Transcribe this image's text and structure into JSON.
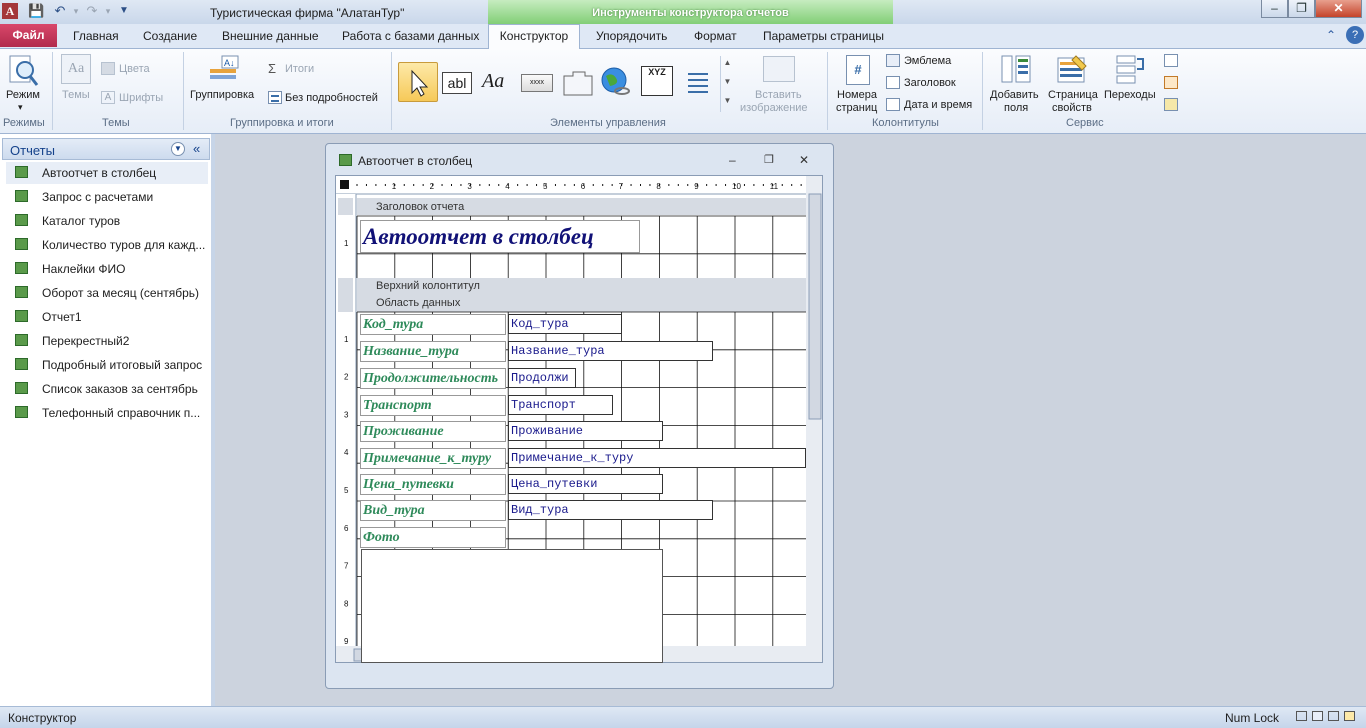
{
  "app": {
    "title": "Туристическая фирма \"АлатанТур\"",
    "context_tools": "Инструменты конструктора отчетов",
    "icon_letter": "A"
  },
  "tabs": {
    "file": "Файл",
    "items": [
      "Главная",
      "Создание",
      "Внешние данные",
      "Работа с базами данных",
      "Конструктор",
      "Упорядочить",
      "Формат",
      "Параметры страницы"
    ]
  },
  "ribbon": {
    "groups": {
      "modes": "Режимы",
      "themes": "Темы",
      "grouping": "Группировка и итоги",
      "controls": "Элементы управления",
      "headers": "Колонтитулы",
      "service": "Сервис"
    },
    "mode": "Режим",
    "themes": "Темы",
    "colors": "Цвета",
    "fonts": "Шрифты",
    "group": "Группировка",
    "totals": "Итоги",
    "no_details": "Без подробностей",
    "insert_image_1": "Вставить",
    "insert_image_2": "изображение",
    "page_numbers_1": "Номера",
    "page_numbers_2": "страниц",
    "emblem": "Эмблема",
    "heading": "Заголовок",
    "date_time": "Дата и время",
    "add_fields_1": "Добавить",
    "add_fields_2": "поля",
    "property_sheet_1": "Страница",
    "property_sheet_2": "свойств",
    "transitions": "Переходы",
    "label_ctrl": "abl",
    "text_ctrl": "Aa",
    "xyz": "XYZ",
    "xxxx": "xxxx"
  },
  "nav": {
    "title": "Отчеты",
    "items": [
      "Автоотчет в столбец",
      "Запрос с расчетами",
      "Каталог туров",
      "Количество туров для кажд...",
      "Наклейки ФИО",
      "Оборот за месяц (сентябрь)",
      "Отчет1",
      "Перекрестный2",
      "Подробный итоговый запрос",
      "Список заказов за сентябрь",
      "Телефонный справочник п..."
    ]
  },
  "report": {
    "window_title": "Автоотчет в столбец",
    "sections": {
      "report_header": "Заголовок отчета",
      "page_header": "Верхний колонтитул",
      "detail": "Область данных"
    },
    "title_label": "Автоотчет в столбец",
    "ruler_numbers": [
      "1",
      "2",
      "3",
      "4",
      "5",
      "6",
      "7",
      "8",
      "9",
      "10",
      "11"
    ],
    "vruler_header": [
      "1"
    ],
    "vruler_detail": [
      "1",
      "2",
      "3",
      "4",
      "5",
      "6",
      "7",
      "8",
      "9"
    ],
    "fields": [
      {
        "label": "Код_тура",
        "value": "Код_тура"
      },
      {
        "label": "Название_тура",
        "value": "Название_тура"
      },
      {
        "label": "Продолжительность",
        "value": "Продолжи"
      },
      {
        "label": "Транспорт",
        "value": "Транспорт"
      },
      {
        "label": "Проживание",
        "value": "Проживание"
      },
      {
        "label": "Примечание_к_туру",
        "value": "Примечание_к_туру"
      },
      {
        "label": "Цена_путевки",
        "value": "Цена_путевки"
      },
      {
        "label": "Вид_тура",
        "value": "Вид_тура"
      },
      {
        "label": "Фото",
        "value": ""
      }
    ]
  },
  "status": {
    "mode": "Конструктор",
    "numlock": "Num Lock"
  },
  "colors": {
    "file_tab": "#b12b4c",
    "context_green": "#7ccc70",
    "label_green": "#2e8a5a",
    "field_blue": "#1a1a8c",
    "title_navy": "#111177"
  }
}
